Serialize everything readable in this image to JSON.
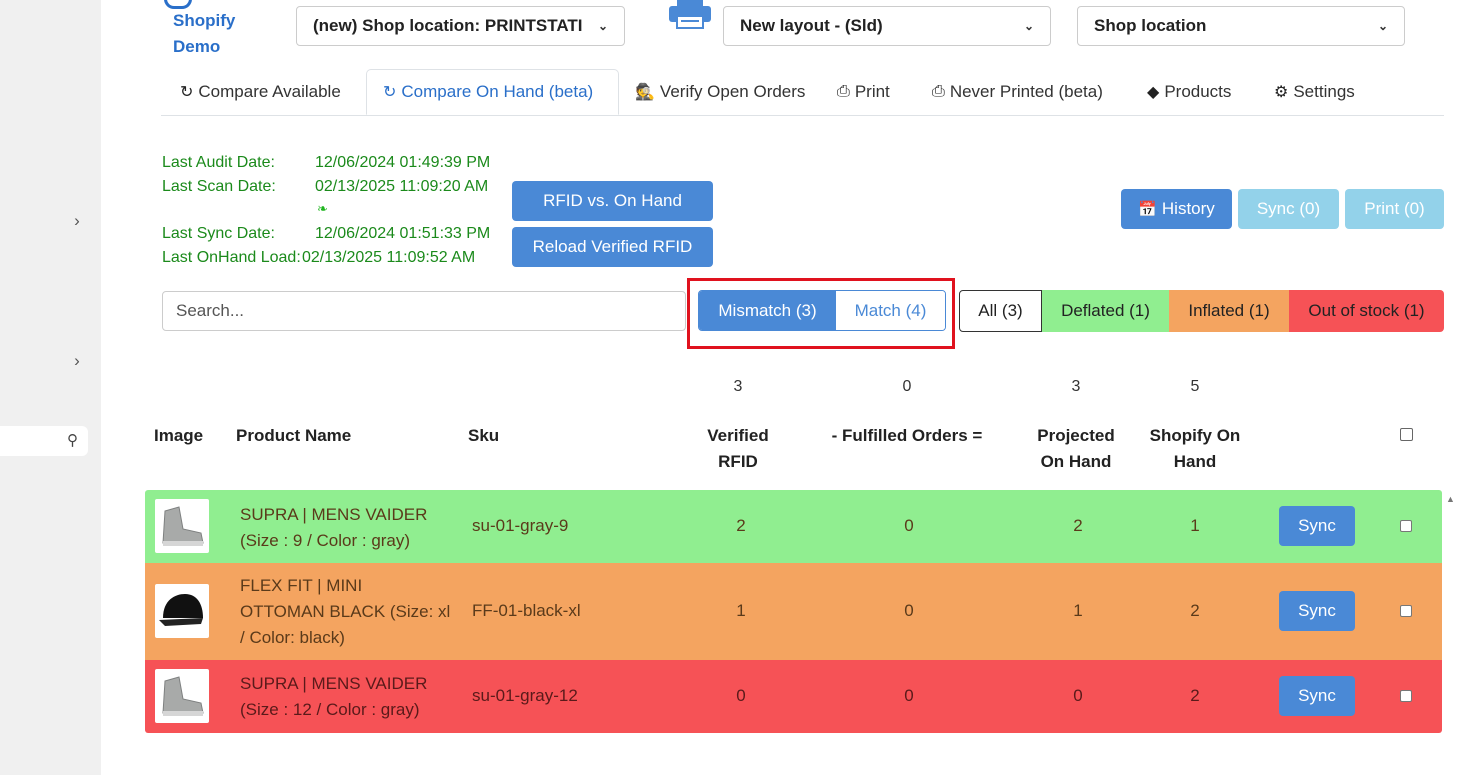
{
  "brand": {
    "line1": "Shopify",
    "line2": "Demo"
  },
  "selectors": {
    "printer": {
      "value": "(new) Shop location: PRINTSTATI"
    },
    "layout": {
      "value": "New layout - (Sld)"
    },
    "location": {
      "value": "Shop location"
    }
  },
  "tabs": [
    {
      "label": "Compare Available",
      "icon": "refresh-icon"
    },
    {
      "label": "Compare On Hand (beta)",
      "icon": "refresh-icon",
      "active": true
    },
    {
      "label": "Verify Open Orders",
      "icon": "user-secret-icon"
    },
    {
      "label": "Print",
      "icon": "print-icon"
    },
    {
      "label": "Never Printed (beta)",
      "icon": "print-icon"
    },
    {
      "label": "Products",
      "icon": "tag-icon"
    },
    {
      "label": "Settings",
      "icon": "gear-icon"
    }
  ],
  "info": {
    "audit_label": "Last Audit Date:",
    "audit_value": "12/06/2024 01:49:39 PM",
    "scan_label": "Last Scan Date:",
    "scan_value": "02/13/2025 11:09:20 AM",
    "sync_label": "Last Sync Date:",
    "sync_value": "12/06/2024 01:51:33 PM",
    "onhand_label": "Last OnHand Load:",
    "onhand_value": "02/13/2025 11:09:52 AM"
  },
  "buttons": {
    "rfid_vs_onhand": "RFID vs. On Hand",
    "reload_verified": "Reload Verified RFID",
    "history": "History",
    "sync": "Sync (0)",
    "print": "Print (0)"
  },
  "search": {
    "placeholder": "Search..."
  },
  "segment": {
    "mismatch": "Mismatch (3)",
    "match": "Match (4)"
  },
  "filters": {
    "all": "All (3)",
    "deflated": "Deflated (1)",
    "inflated": "Inflated (1)",
    "out_of_stock": "Out of stock (1)"
  },
  "totals": {
    "verified": "3",
    "fulfilled": "0",
    "projected": "3",
    "shopify": "5"
  },
  "columns": {
    "image": "Image",
    "product": "Product Name",
    "sku": "Sku",
    "verified_1": "Verified",
    "verified_2": "RFID",
    "fulfilled": "- Fulfilled Orders =",
    "projected_1": "Projected",
    "projected_2": "On Hand",
    "shopify_1": "Shopify On",
    "shopify_2": "Hand"
  },
  "rows": [
    {
      "name_1": "SUPRA | MENS VAIDER",
      "name_2": "(Size : 9 / Color : gray)",
      "name_3": "",
      "sku": "su-01-gray-9",
      "verified": "2",
      "fulfilled": "0",
      "projected": "2",
      "shopify": "1",
      "sync": "Sync",
      "status": "deflated",
      "bg": "#90ee90",
      "thumb": "shoe-thumbnail"
    },
    {
      "name_1": "FLEX FIT | MINI",
      "name_2": "OTTOMAN BLACK (Size: xl",
      "name_3": "/ Color: black)",
      "sku": "FF-01-black-xl",
      "verified": "1",
      "fulfilled": "0",
      "projected": "1",
      "shopify": "2",
      "sync": "Sync",
      "status": "inflated",
      "bg": "#f4a460",
      "thumb": "cap-thumbnail"
    },
    {
      "name_1": "SUPRA | MENS VAIDER",
      "name_2": "(Size : 12 / Color : gray)",
      "name_3": "",
      "sku": "su-01-gray-12",
      "verified": "0",
      "fulfilled": "0",
      "projected": "0",
      "shopify": "2",
      "sync": "Sync",
      "status": "out-of-stock",
      "bg": "#f65256",
      "thumb": "shoe-thumbnail"
    }
  ],
  "colors": {
    "accent": "#4a89d6",
    "deflated": "#90ee90",
    "inflated": "#f4a460",
    "out_of_stock": "#f65256",
    "info_green": "#1b8a1b",
    "highlight": "#e0121e"
  }
}
